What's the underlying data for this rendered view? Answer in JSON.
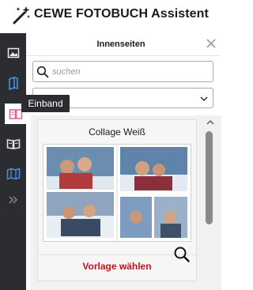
{
  "app": {
    "title": "CEWE FOTOBUCH Assistent"
  },
  "sidebar": {
    "items": [
      {
        "name": "photos",
        "icon": "image-icon"
      },
      {
        "name": "pages",
        "icon": "pages-icon",
        "color": "#4a90e2"
      },
      {
        "name": "cover",
        "icon": "book-cover-icon",
        "color": "#e05a9a",
        "active": true
      },
      {
        "name": "open-book",
        "icon": "open-book-icon"
      },
      {
        "name": "map",
        "icon": "map-icon",
        "color": "#4a90e2"
      },
      {
        "name": "expand",
        "icon": "double-chevron-right-icon"
      }
    ],
    "tooltip": "Einband"
  },
  "panel": {
    "title": "Innenseiten",
    "search": {
      "placeholder": "suchen",
      "value": ""
    },
    "dropdown": {
      "value": ""
    }
  },
  "templates": [
    {
      "title": "Collage Weiß",
      "action_label": "Vorlage wählen"
    }
  ],
  "colors": {
    "sidebar_bg": "#2b2d31",
    "action_red": "#c0141d",
    "accent_blue": "#4a90e2",
    "accent_pink": "#e05a9a"
  }
}
